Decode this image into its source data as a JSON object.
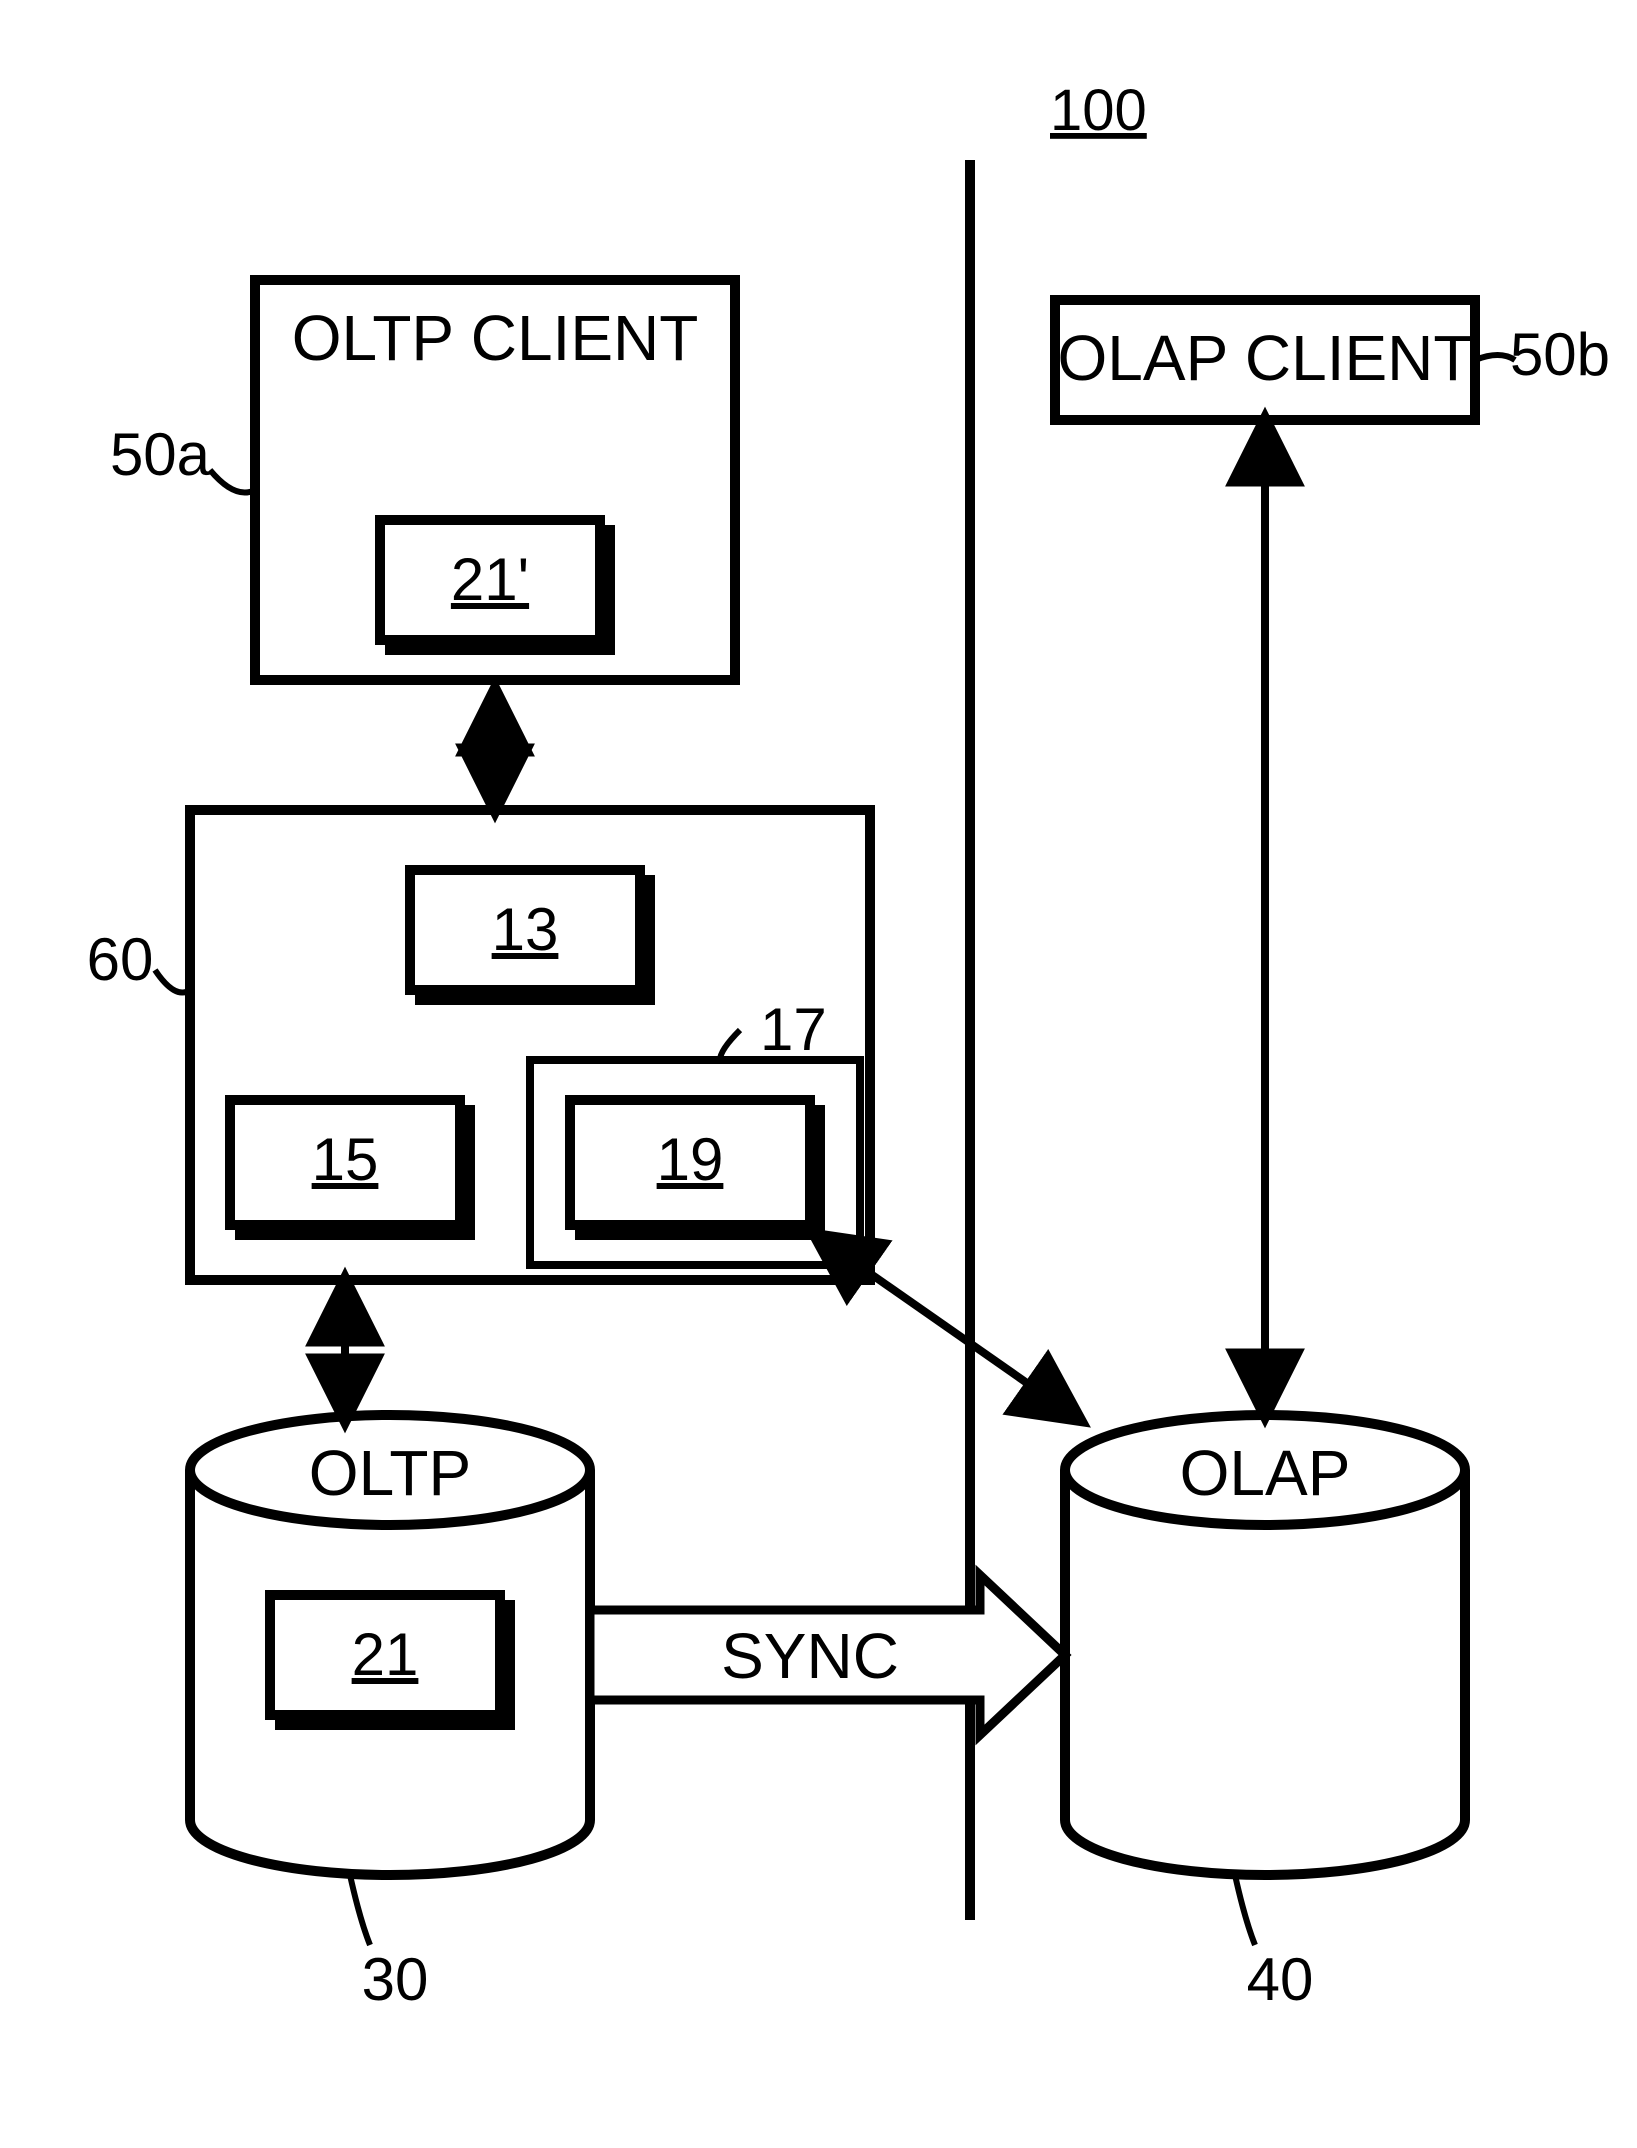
{
  "figure_ref": "100",
  "clients": {
    "oltp": {
      "label": "OLTP CLIENT",
      "ref": "50a",
      "inner_ref": "21'"
    },
    "olap": {
      "label": "OLAP CLIENT",
      "ref": "50b"
    }
  },
  "middle_block": {
    "ref": "60",
    "nodes": {
      "top": {
        "ref": "13"
      },
      "left": {
        "ref": "15"
      },
      "right_outer": {
        "ref": "17"
      },
      "right_inner": {
        "ref": "19"
      }
    }
  },
  "databases": {
    "oltp": {
      "label": "OLTP",
      "ref": "30",
      "inner_ref": "21"
    },
    "olap": {
      "label": "OLAP",
      "ref": "40"
    }
  },
  "sync_label": "SYNC"
}
